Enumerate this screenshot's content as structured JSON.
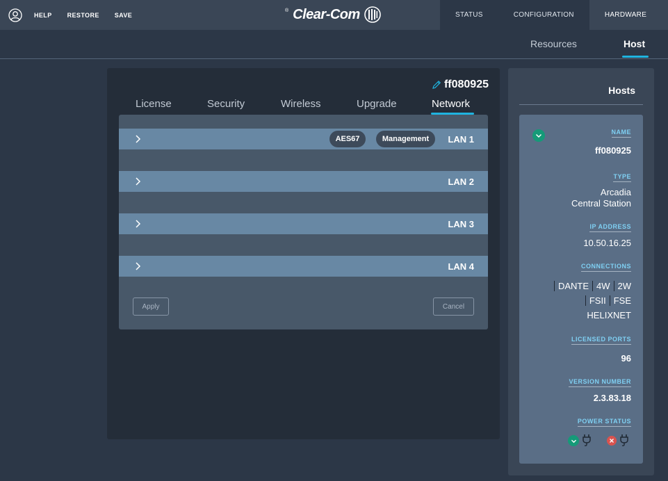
{
  "top_bar": {
    "links": {
      "help": "HELP",
      "restore": "RESTORE",
      "save": "SAVE"
    },
    "logo": {
      "text": "Clear-Com",
      "tm": "®"
    },
    "tabs": {
      "status": "STATUS",
      "configuration": "CONFIGURATION",
      "hardware": "HARDWARE"
    },
    "active_tab": "HARDWARE"
  },
  "sub_nav": {
    "resources": "Resources",
    "host": "Host",
    "active": "Host"
  },
  "host_panel": {
    "title": "ff080925",
    "tabs": {
      "license": "License",
      "security": "Security",
      "wireless": "Wireless",
      "upgrade": "Upgrade",
      "network": "Network"
    },
    "active_tab": "Network",
    "lans": [
      {
        "label": "LAN 1",
        "badges": [
          "AES67",
          "Management"
        ]
      },
      {
        "label": "LAN 2",
        "badges": []
      },
      {
        "label": "LAN 3",
        "badges": []
      },
      {
        "label": "LAN 4",
        "badges": []
      }
    ],
    "buttons": {
      "apply": "Apply",
      "cancel": "Cancel"
    }
  },
  "hosts_sidebar": {
    "title": "Hosts",
    "host": {
      "name_label": "NAME",
      "name": "ff080925",
      "type_label": "TYPE",
      "type_line1": "Arcadia",
      "type_line2": "Central Station",
      "ip_label": "IP ADDRESS",
      "ip": "10.50.16.25",
      "connections_label": "CONNECTIONS",
      "connections": {
        "row1": [
          "2W",
          "4W",
          "DANTE"
        ],
        "row2": [
          "FSE",
          "FSII"
        ],
        "row3": [
          "HELIXNET"
        ]
      },
      "licensed_ports_label": "LICENSED PORTS",
      "licensed_ports": "96",
      "version_label": "VERSION NUMBER",
      "version": "2.3.83.18",
      "power_label": "POWER STATUS",
      "power_status": [
        "error",
        "ok"
      ]
    }
  },
  "colors": {
    "accent": "#1fb4e0",
    "ok": "#159a78",
    "error": "#d9534f",
    "label": "#7fd0f3"
  }
}
